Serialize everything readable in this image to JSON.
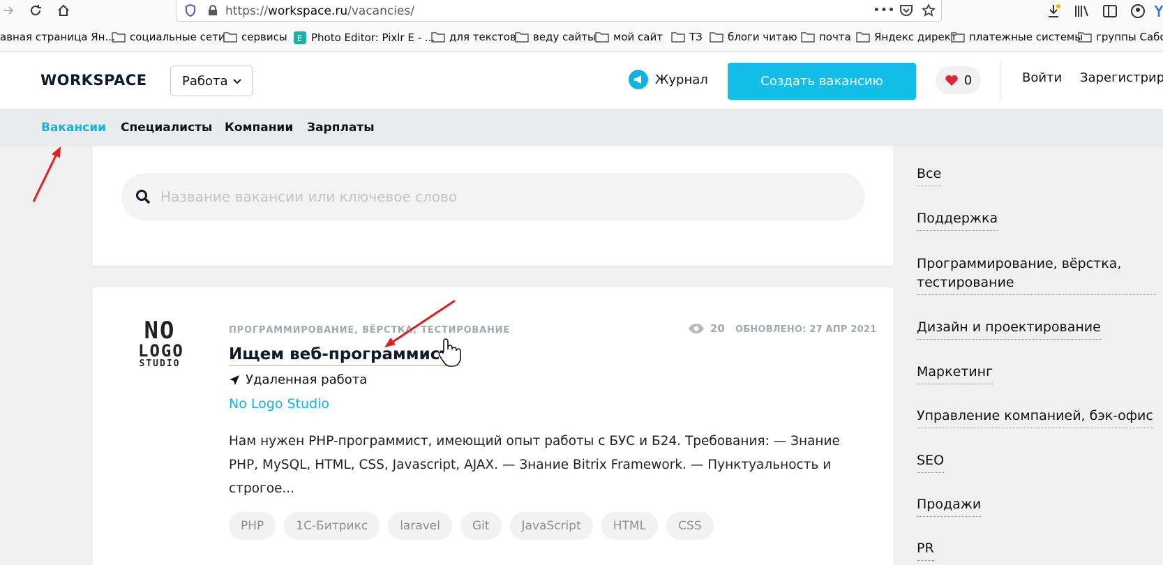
{
  "browser": {
    "url_prefix": "https://",
    "url_domain": "workspace.ru",
    "url_path": "/vacancies/",
    "bookmarks": [
      "авная страница Ян...",
      "социальные сети",
      "сервисы",
      "Photo Editor: Pixlr E - ...",
      "для текстов",
      "веду сайты",
      "мой  сайт",
      "ТЗ",
      "блоги читаю",
      "почта",
      "Яндекс директ",
      "платежные системы",
      "группы Сабск"
    ]
  },
  "header": {
    "logo": "WORKSPACE",
    "work_select": "Работа",
    "journal": "Журнал",
    "create_vacancy": "Создать вакансию",
    "favorites_count": "0",
    "login": "Войти",
    "register": "Зарегистриро"
  },
  "subnav": {
    "items": [
      "Вакансии",
      "Специалисты",
      "Компании",
      "Зарплаты"
    ],
    "active": "Вакансии"
  },
  "search": {
    "placeholder": "Название вакансии или ключевое слово"
  },
  "vacancy": {
    "logo_top": "NO",
    "logo_mid": "LOGO",
    "logo_bottom": "STUDIO",
    "category": "ПРОГРАММИРОВАНИЕ, ВЁРСТКА, ТЕСТИРОВАНИЕ",
    "views": "20",
    "updated": "ОБНОВЛЕНО: 27 АПР 2021",
    "title": "Ищем веб-программиста",
    "location": "Удаленная работа",
    "company": "No Logo Studio",
    "description": "Нам нужен PHP-программист, имеющий опыт работы с БУС и Б24. Требования: — Знание PHP, MySQL, HTML, CSS, Javascript, AJAX. — Знание Bitrix Framework. — Пунктуальность и строгое...",
    "tags": [
      "PHP",
      "1С-Битрикс",
      "laravel",
      "Git",
      "JavaScript",
      "HTML",
      "CSS"
    ]
  },
  "categories": [
    "Все",
    "Поддержка",
    "Программирование, вёрстка,",
    "тестирование",
    "Дизайн и проектирование",
    "Маркетинг",
    "Управление компанией, бэк-офис",
    "SEO",
    "Продажи",
    "PR"
  ],
  "colors": {
    "accent": "#13b3de",
    "button": "#12bde8",
    "annotation": "#e31e1e"
  }
}
